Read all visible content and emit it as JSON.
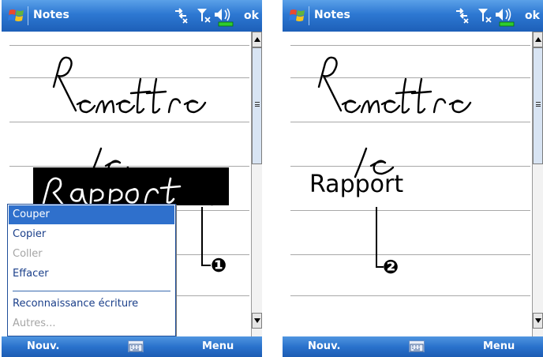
{
  "screens": [
    {
      "title": "Notes",
      "ok_label": "ok",
      "menubar": {
        "left": "Nouv.",
        "right": "Menu"
      },
      "handwriting": [
        "Remettre",
        "le",
        "Rapport"
      ],
      "context_menu": {
        "items": [
          {
            "label": "Couper",
            "state": "selected"
          },
          {
            "label": "Copier",
            "state": "enabled"
          },
          {
            "label": "Coller",
            "state": "disabled"
          },
          {
            "label": "Effacer",
            "state": "enabled"
          },
          {
            "label": "Reconnaissance écriture",
            "state": "enabled"
          },
          {
            "label": "Autres...",
            "state": "disabled"
          }
        ]
      },
      "callout": "1"
    },
    {
      "title": "Notes",
      "ok_label": "ok",
      "menubar": {
        "left": "Nouv.",
        "right": "Menu"
      },
      "handwriting": [
        "Remettre",
        "le"
      ],
      "recognized_text": "Rapport",
      "callout": "2"
    }
  ],
  "icons": {
    "start": "windows-flag-icon",
    "connectivity": "connectivity-icon",
    "signal": "signal-off-icon",
    "volume": "speaker-muted-icon",
    "battery": "battery-icon",
    "keyboard": "keyboard-icon"
  },
  "colors": {
    "titlebar": "#2d78d2",
    "selection": "#2f70cc",
    "menu_text": "#1a3f8a",
    "disabled": "#a5a5a5",
    "battery": "#2ecc2e"
  }
}
